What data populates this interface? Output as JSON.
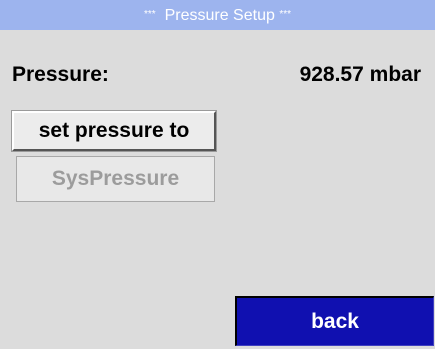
{
  "header": {
    "decoration_left": "***",
    "title": "Pressure Setup",
    "decoration_right": "***"
  },
  "pressure": {
    "label": "Pressure:",
    "value": "928.57",
    "unit": "mbar"
  },
  "buttons": {
    "set_pressure": "set pressure to",
    "sys_pressure": "SysPressure",
    "back": "back"
  },
  "colors": {
    "title_bar": "#9db4ee",
    "background": "#dcdcdc",
    "back_button": "#1010b0"
  }
}
